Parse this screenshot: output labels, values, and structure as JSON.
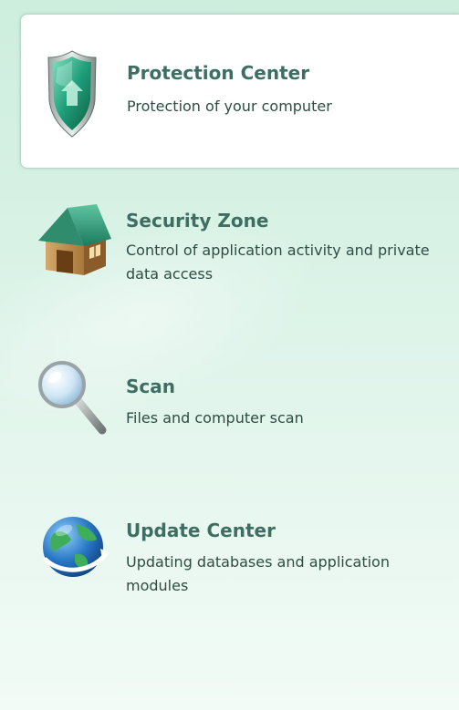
{
  "nav": {
    "items": [
      {
        "title": "Protection Center",
        "description": "Protection of your computer",
        "icon": "shield-icon",
        "active": true
      },
      {
        "title": "Security Zone",
        "description": "Control of application activity and private data access",
        "icon": "house-icon",
        "active": false
      },
      {
        "title": "Scan",
        "description": "Files and computer scan",
        "icon": "magnifier-icon",
        "active": false
      },
      {
        "title": "Update Center",
        "description": "Updating databases and application modules",
        "icon": "globe-icon",
        "active": false
      }
    ]
  },
  "colors": {
    "title": "#3e6e62",
    "text": "#2e4d44",
    "background": "#d9f2e6",
    "active_border": "#b9d6c7"
  }
}
